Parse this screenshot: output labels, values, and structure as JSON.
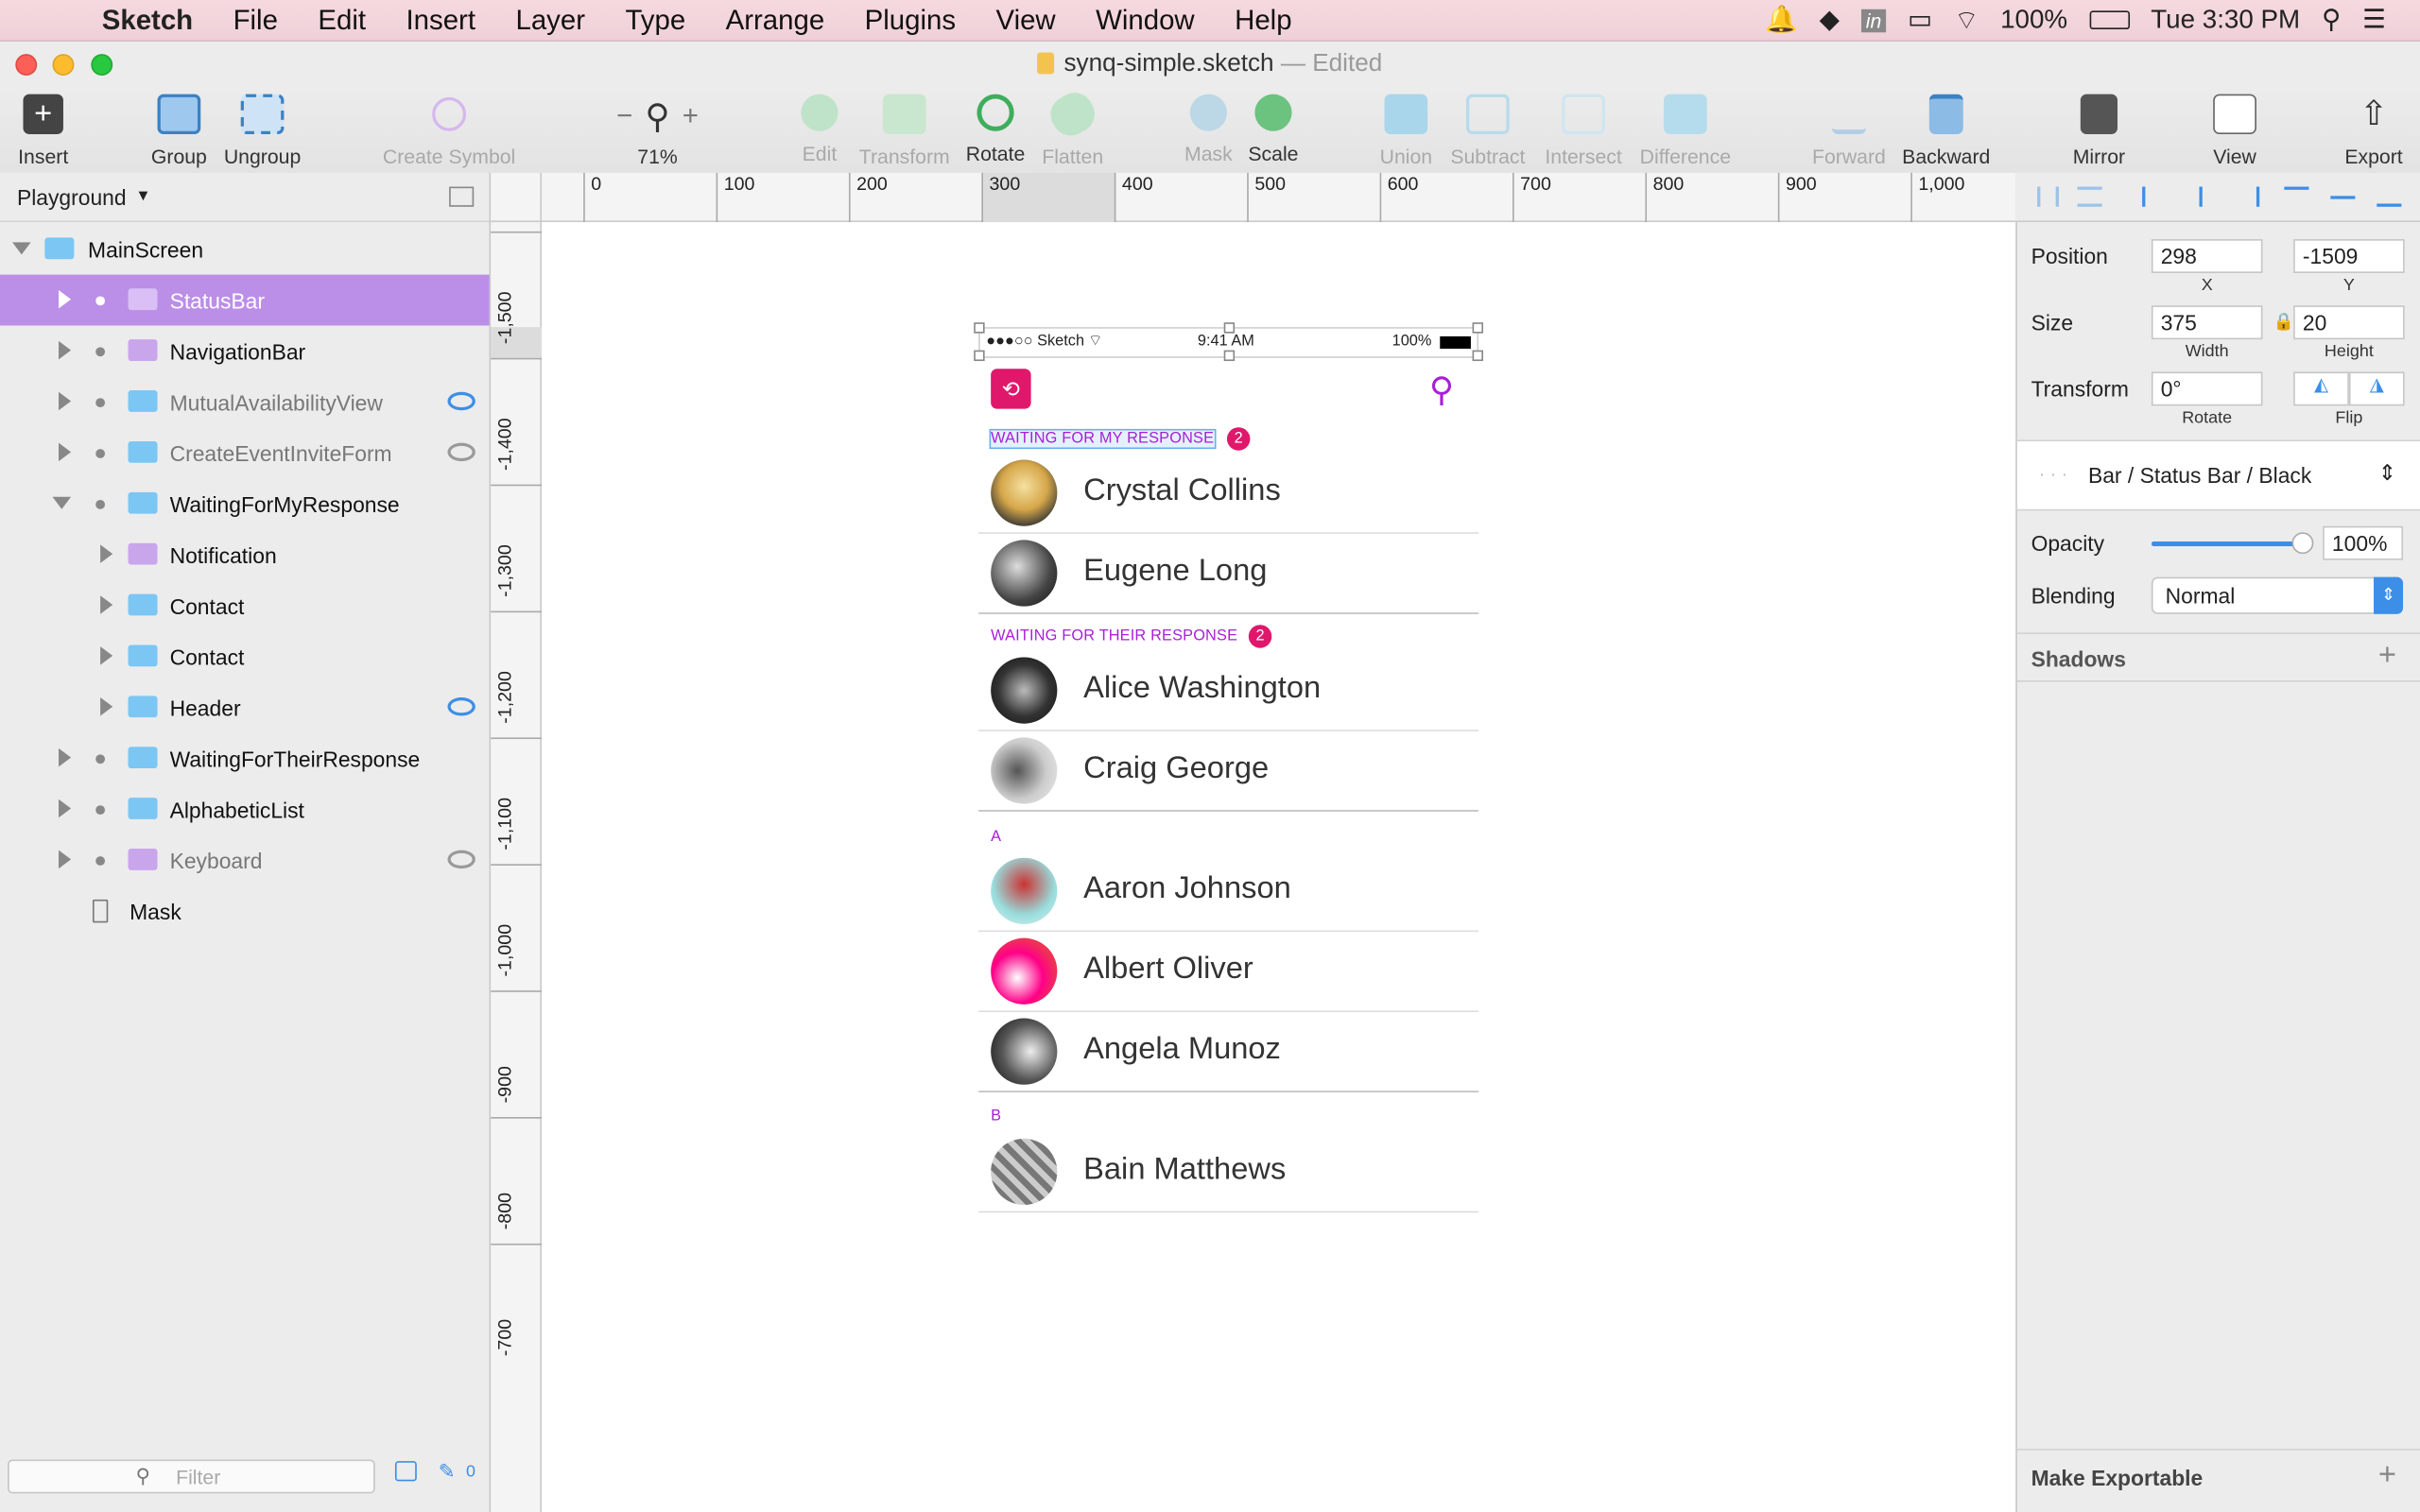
{
  "menubar": {
    "app": "Sketch",
    "items": [
      "File",
      "Edit",
      "Insert",
      "Layer",
      "Type",
      "Arrange",
      "Plugins",
      "View",
      "Window",
      "Help"
    ],
    "battery": "100%",
    "clock": "Tue 3:30 PM"
  },
  "window": {
    "filename": "synq-simple.sketch",
    "state": "— Edited"
  },
  "toolbar": {
    "insert": "Insert",
    "group": "Group",
    "ungroup": "Ungroup",
    "create_symbol": "Create Symbol",
    "zoom": "71%",
    "edit": "Edit",
    "transform": "Transform",
    "rotate": "Rotate",
    "flatten": "Flatten",
    "mask": "Mask",
    "scale": "Scale",
    "union": "Union",
    "subtract": "Subtract",
    "intersect": "Intersect",
    "difference": "Difference",
    "forward": "Forward",
    "backward": "Backward",
    "mirror": "Mirror",
    "view": "View",
    "export": "Export"
  },
  "layers": {
    "page": "Playground",
    "items": [
      {
        "name": "MainScreen"
      },
      {
        "name": "StatusBar"
      },
      {
        "name": "NavigationBar"
      },
      {
        "name": "MutualAvailabilityView"
      },
      {
        "name": "CreateEventInviteForm"
      },
      {
        "name": "WaitingForMyResponse"
      },
      {
        "name": "Notification"
      },
      {
        "name": "Contact"
      },
      {
        "name": "Contact"
      },
      {
        "name": "Header"
      },
      {
        "name": "WaitingForTheirResponse"
      },
      {
        "name": "AlphabeticList"
      },
      {
        "name": "Keyboard"
      },
      {
        "name": "Mask"
      }
    ],
    "filter_placeholder": "Filter",
    "slice_count": "0"
  },
  "rulers": {
    "h": [
      "0",
      "100",
      "200",
      "300",
      "400",
      "500",
      "600",
      "700",
      "800",
      "900",
      "1,000"
    ],
    "v": [
      "-1,500",
      "-1,400",
      "-1,300",
      "-1,200",
      "-1,100",
      "-1,000",
      "-900",
      "-800",
      "-700"
    ]
  },
  "artboard": {
    "statusbar": {
      "carrier": "●●●○○ Sketch",
      "time": "9:41 AM",
      "battery": "100%"
    },
    "section1": {
      "label": "WAITING FOR MY RESPONSE",
      "count": "2"
    },
    "section2": {
      "label": "WAITING FOR THEIR RESPONSE",
      "count": "2"
    },
    "contacts": [
      {
        "name": "Crystal Collins"
      },
      {
        "name": "Eugene Long"
      },
      {
        "name": "Alice Washington"
      },
      {
        "name": "Craig George"
      },
      {
        "name": "Aaron Johnson"
      },
      {
        "name": "Albert Oliver"
      },
      {
        "name": "Angela Munoz"
      },
      {
        "name": "Bain Matthews"
      }
    ],
    "letter_a": "A",
    "letter_b": "B"
  },
  "inspector": {
    "position_label": "Position",
    "x": "298",
    "y": "-1509",
    "x_label": "X",
    "y_label": "Y",
    "size_label": "Size",
    "width": "375",
    "height": "20",
    "width_label": "Width",
    "height_label": "Height",
    "transform_label": "Transform",
    "rotate_value": "0°",
    "rotate_label": "Rotate",
    "flip_label": "Flip",
    "symbol": "Bar / Status Bar / Black",
    "opacity_label": "Opacity",
    "opacity": "100%",
    "opacity_level": 1.0,
    "blending_label": "Blending",
    "blending": "Normal",
    "shadows": "Shadows",
    "make_exportable": "Make Exportable"
  }
}
